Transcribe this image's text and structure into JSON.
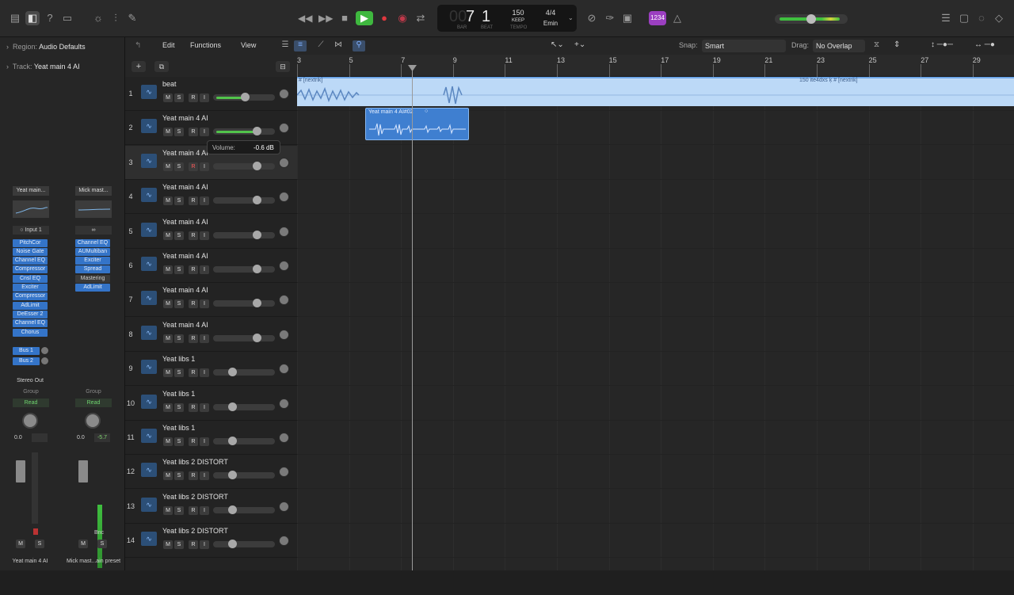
{
  "lcd": {
    "bar": "7",
    "beat": "1",
    "bar_label": "BAR",
    "beat_label": "BEAT",
    "tempo": "150",
    "tempo_mode": "KEEP",
    "tempo_label": "TEMPO",
    "signature": "4/4",
    "key": "Emin"
  },
  "count_in": "1234",
  "inspector": {
    "region_label": "Region:",
    "region_value": "Audio Defaults",
    "track_label": "Track:",
    "track_value": "Yeat main 4 AI",
    "strip1": {
      "name": "Yeat main...",
      "input": "Input 1",
      "plugins": [
        "PitchCor",
        "Noise Gate",
        "Channel EQ",
        "Compressor",
        "Cnsl EQ",
        "Exciter",
        "Compressor",
        "AdLimit",
        "DeEsser 2",
        "Channel EQ",
        "Chorus"
      ],
      "sends": [
        "Bus 1",
        "Bus 2"
      ],
      "output": "Stereo Out",
      "group": "Group",
      "automation": "Read",
      "vol": "0.0",
      "mute": "M",
      "solo": "S",
      "footer": "Yeat main 4 AI"
    },
    "strip2": {
      "name": "Mick mast...",
      "plugins": [
        "Channel EQ",
        "AUMultiban",
        "Exciter",
        "Spread",
        "Mastering",
        "AdLimit"
      ],
      "group": "Group",
      "automation": "Read",
      "vol": "0.0",
      "peak": "-5.7",
      "bnc": "Bnc",
      "mute": "M",
      "solo": "S",
      "footer": "Mick mast...ain preset"
    }
  },
  "tracks": [
    {
      "num": "1",
      "name": "beat"
    },
    {
      "num": "2",
      "name": "Yeat main 4 AI"
    },
    {
      "num": "3",
      "name": "Yeat main 4 AI"
    },
    {
      "num": "4",
      "name": "Yeat main 4 AI"
    },
    {
      "num": "5",
      "name": "Yeat main 4 AI"
    },
    {
      "num": "6",
      "name": "Yeat main 4 AI"
    },
    {
      "num": "7",
      "name": "Yeat main 4 AI"
    },
    {
      "num": "8",
      "name": "Yeat main 4 AI"
    },
    {
      "num": "9",
      "name": "Yeat libs 1"
    },
    {
      "num": "10",
      "name": "Yeat libs 1"
    },
    {
      "num": "11",
      "name": "Yeat libs 1"
    },
    {
      "num": "12",
      "name": "Yeat libs 2 DISTORT"
    },
    {
      "num": "13",
      "name": "Yeat libs 2 DISTORT"
    },
    {
      "num": "14",
      "name": "Yeat libs 2 DISTORT"
    }
  ],
  "track_buttons": {
    "m": "M",
    "s": "S",
    "r": "R",
    "i": "I"
  },
  "tooltip": {
    "label": "Volume:",
    "value": "-0.6 dB"
  },
  "arrange_menu": {
    "edit": "Edit",
    "functions": "Functions",
    "view": "View",
    "snap_label": "Snap:",
    "snap_value": "Smart",
    "drag_label": "Drag:",
    "drag_value": "No Overlap"
  },
  "ruler": [
    "3",
    "5",
    "7",
    "9",
    "11",
    "13",
    "15",
    "17",
    "19",
    "21",
    "23",
    "25",
    "27",
    "29"
  ],
  "regions": {
    "beat_left": "# [nextrik]",
    "beat_right": "150 ite4dxs ķ # [nextrik]",
    "yeat": "Yeat main 4 AI#02"
  }
}
